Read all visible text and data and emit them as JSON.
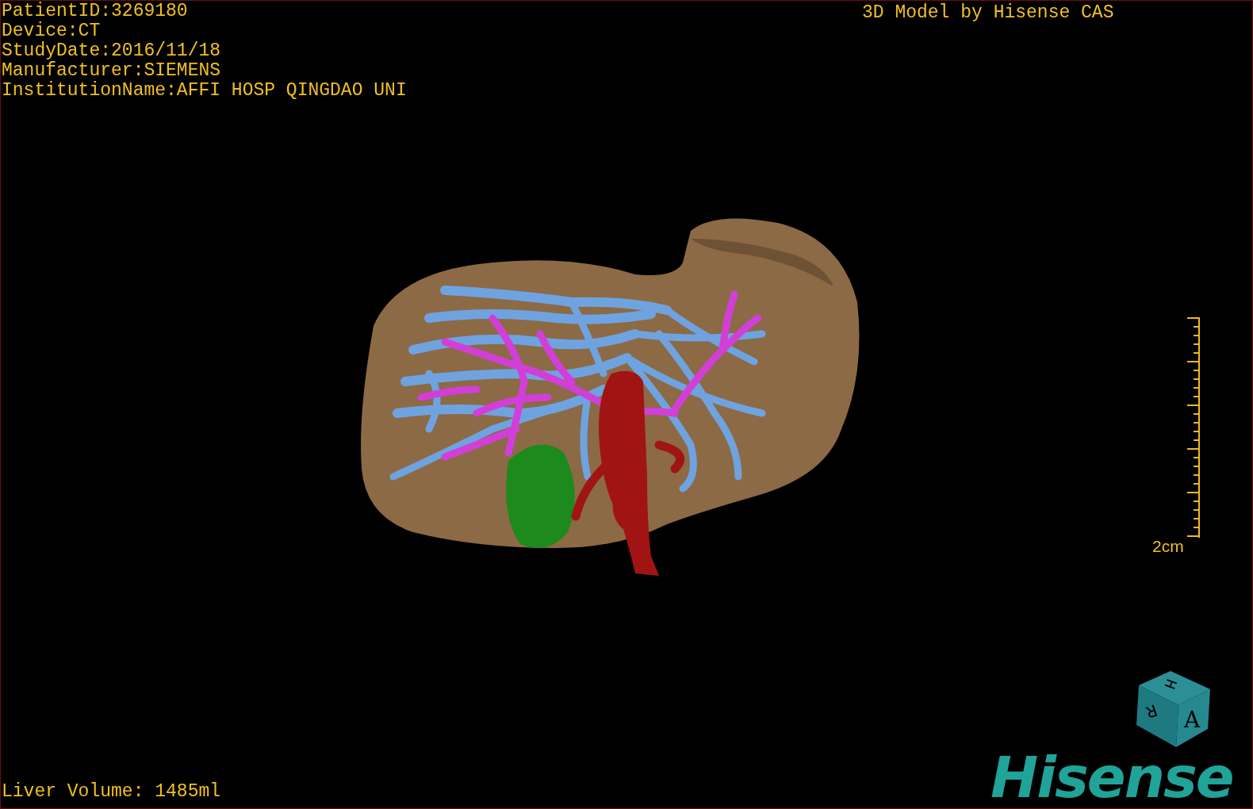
{
  "patient_info": [
    "PatientID:3269180",
    "Device:CT",
    "StudyDate:2016/11/18",
    "Manufacturer:SIEMENS",
    "InstitutionName:AFFI HOSP QINGDAO UNI"
  ],
  "model_credit": "3D Model by Hisense CAS",
  "scale_bar": {
    "label": "2cm"
  },
  "orientation_cube": {
    "faces": [
      "H",
      "R",
      "A"
    ]
  },
  "logo": "Hisense",
  "liver_volume": "Liver Volume: 1485ml"
}
